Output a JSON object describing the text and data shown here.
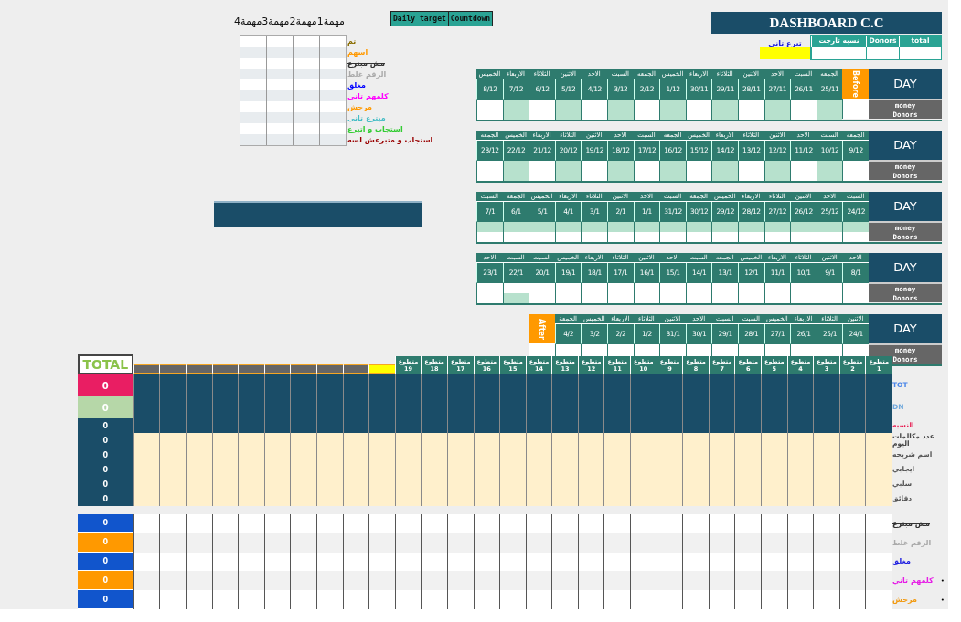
{
  "tasks": {
    "headings": [
      "مهمة1",
      "مهمة2",
      "مهمة3",
      "مهمة4"
    ],
    "statuses": [
      {
        "label": "تم",
        "color": "#8a6d00",
        "struck": false
      },
      {
        "label": "اسهم",
        "color": "#ff9900",
        "struck": false
      },
      {
        "label": "مش مبترع",
        "color": "#333333",
        "struck": true
      },
      {
        "label": "الرقم غلط",
        "color": "#aaaaaa",
        "struck": false
      },
      {
        "label": "مغلق",
        "color": "#0000ff",
        "struck": false
      },
      {
        "label": "كلمهم تاني",
        "color": "#ff00ff",
        "struck": false
      },
      {
        "label": "مرحش",
        "color": "#ff9900",
        "struck": false
      },
      {
        "label": "مبترع تاني",
        "color": "#46bdc6",
        "struck": false
      },
      {
        "label": "استجاب و اتبرع",
        "color": "#33cc33",
        "struck": false
      },
      {
        "label": "استجاب و متبرعش لسه",
        "color": "#990000",
        "struck": false
      }
    ]
  },
  "buttons": [
    {
      "label": "Countdown"
    },
    {
      "label": "Daily target"
    }
  ],
  "dashboard": {
    "title": "DASHBOARD C.C",
    "second_donation": "تبرع تاني",
    "summary_columns": [
      "total",
      "Donors",
      "نسبه تارجت"
    ]
  },
  "weeks": [
    {
      "edge": {
        "kind": "before",
        "label": "Before"
      },
      "day_label": "DAY",
      "money_label": "money",
      "donors_label": "Donors",
      "days": [
        {
          "name": "الجمعه",
          "date": "25/11",
          "money_shaded": true,
          "donors_shaded": true
        },
        {
          "name": "السبت",
          "date": "26/11",
          "money_shaded": false,
          "donors_shaded": false
        },
        {
          "name": "الاحد",
          "date": "27/11",
          "money_shaded": true,
          "donors_shaded": true
        },
        {
          "name": "الاثنين",
          "date": "28/11",
          "money_shaded": false,
          "donors_shaded": false
        },
        {
          "name": "الثلاثاء",
          "date": "29/11",
          "money_shaded": true,
          "donors_shaded": true
        },
        {
          "name": "الاربعاء",
          "date": "30/11",
          "money_shaded": false,
          "donors_shaded": false
        },
        {
          "name": "الخميس",
          "date": "1/12",
          "money_shaded": true,
          "donors_shaded": true
        },
        {
          "name": "الجمعه",
          "date": "2/12",
          "money_shaded": false,
          "donors_shaded": false
        },
        {
          "name": "السبت",
          "date": "3/12",
          "money_shaded": true,
          "donors_shaded": true
        },
        {
          "name": "الاحد",
          "date": "4/12",
          "money_shaded": false,
          "donors_shaded": false
        },
        {
          "name": "الاثنين",
          "date": "5/12",
          "money_shaded": true,
          "donors_shaded": true
        },
        {
          "name": "الثلاثاء",
          "date": "6/12",
          "money_shaded": false,
          "donors_shaded": false
        },
        {
          "name": "الاربعاء",
          "date": "7/12",
          "money_shaded": true,
          "donors_shaded": true
        },
        {
          "name": "الخميس",
          "date": "8/12",
          "money_shaded": false,
          "donors_shaded": false
        }
      ]
    },
    {
      "day_label": "DAY",
      "money_label": "money",
      "donors_label": "Donors",
      "days": [
        {
          "name": "الجمعه",
          "date": "9/12",
          "money_shaded": false,
          "donors_shaded": false
        },
        {
          "name": "السبت",
          "date": "10/12",
          "money_shaded": true,
          "donors_shaded": true
        },
        {
          "name": "الاحد",
          "date": "11/12",
          "money_shaded": false,
          "donors_shaded": false
        },
        {
          "name": "الاثنين",
          "date": "12/12",
          "money_shaded": true,
          "donors_shaded": true
        },
        {
          "name": "الثلاثاء",
          "date": "13/12",
          "money_shaded": false,
          "donors_shaded": false
        },
        {
          "name": "الاربعاء",
          "date": "14/12",
          "money_shaded": true,
          "donors_shaded": true
        },
        {
          "name": "الخميس",
          "date": "15/12",
          "money_shaded": false,
          "donors_shaded": false
        },
        {
          "name": "الجمعه",
          "date": "16/12",
          "money_shaded": true,
          "donors_shaded": true
        },
        {
          "name": "السبت",
          "date": "17/12",
          "money_shaded": false,
          "donors_shaded": false
        },
        {
          "name": "الاحد",
          "date": "18/12",
          "money_shaded": true,
          "donors_shaded": true
        },
        {
          "name": "الاثنين",
          "date": "19/12",
          "money_shaded": false,
          "donors_shaded": false
        },
        {
          "name": "الثلاثاء",
          "date": "20/12",
          "money_shaded": true,
          "donors_shaded": true
        },
        {
          "name": "الاربعاء",
          "date": "21/12",
          "money_shaded": false,
          "donors_shaded": false
        },
        {
          "name": "الخميس",
          "date": "22/12",
          "money_shaded": true,
          "donors_shaded": true
        },
        {
          "name": "الجمعه",
          "date": "23/12",
          "money_shaded": false,
          "donors_shaded": false
        }
      ]
    },
    {
      "day_label": "DAY",
      "money_label": "money",
      "donors_label": "Donors",
      "days": [
        {
          "name": "السبت",
          "date": "24/12",
          "money_shaded": true,
          "donors_shaded": false
        },
        {
          "name": "الاحد",
          "date": "25/12",
          "money_shaded": true,
          "donors_shaded": false
        },
        {
          "name": "الاثنين",
          "date": "26/12",
          "money_shaded": true,
          "donors_shaded": false
        },
        {
          "name": "الثلاثاء",
          "date": "27/12",
          "money_shaded": true,
          "donors_shaded": false
        },
        {
          "name": "الاربعاء",
          "date": "28/12",
          "money_shaded": true,
          "donors_shaded": false
        },
        {
          "name": "الخميس",
          "date": "29/12",
          "money_shaded": true,
          "donors_shaded": false
        },
        {
          "name": "الجمعه",
          "date": "30/12",
          "money_shaded": true,
          "donors_shaded": false
        },
        {
          "name": "السبت",
          "date": "31/12",
          "money_shaded": true,
          "donors_shaded": false
        },
        {
          "name": "الاحد",
          "date": "1/1",
          "money_shaded": true,
          "donors_shaded": false
        },
        {
          "name": "الاثنين",
          "date": "2/1",
          "money_shaded": true,
          "donors_shaded": false
        },
        {
          "name": "الثلاثاء",
          "date": "3/1",
          "money_shaded": true,
          "donors_shaded": false
        },
        {
          "name": "الاربعاء",
          "date": "4/1",
          "money_shaded": true,
          "donors_shaded": false
        },
        {
          "name": "الخميس",
          "date": "5/1",
          "money_shaded": true,
          "donors_shaded": false
        },
        {
          "name": "الجمعه",
          "date": "6/1",
          "money_shaded": true,
          "donors_shaded": false
        },
        {
          "name": "السبت",
          "date": "7/1",
          "money_shaded": true,
          "donors_shaded": false
        }
      ]
    },
    {
      "day_label": "DAY",
      "money_label": "money",
      "donors_label": "Donors",
      "days": [
        {
          "name": "الاحد",
          "date": "8/1",
          "money_shaded": false,
          "donors_shaded": false
        },
        {
          "name": "الاثنين",
          "date": "9/1",
          "money_shaded": false,
          "donors_shaded": false
        },
        {
          "name": "الثلاثاء",
          "date": "10/1",
          "money_shaded": false,
          "donors_shaded": false
        },
        {
          "name": "الاربعاء",
          "date": "11/1",
          "money_shaded": false,
          "donors_shaded": false
        },
        {
          "name": "الخميس",
          "date": "12/1",
          "money_shaded": false,
          "donors_shaded": false
        },
        {
          "name": "الجمعه",
          "date": "13/1",
          "money_shaded": false,
          "donors_shaded": false
        },
        {
          "name": "السبت",
          "date": "14/1",
          "money_shaded": false,
          "donors_shaded": false
        },
        {
          "name": "الاحد",
          "date": "15/1",
          "money_shaded": false,
          "donors_shaded": false
        },
        {
          "name": "الاثنين",
          "date": "16/1",
          "money_shaded": false,
          "donors_shaded": false
        },
        {
          "name": "الثلاثاء",
          "date": "17/1",
          "money_shaded": false,
          "donors_shaded": false
        },
        {
          "name": "الاربعاء",
          "date": "18/1",
          "money_shaded": false,
          "donors_shaded": false
        },
        {
          "name": "الخميس",
          "date": "19/1",
          "money_shaded": false,
          "donors_shaded": false
        },
        {
          "name": "السبت",
          "date": "20/1",
          "money_shaded": false,
          "donors_shaded": false
        },
        {
          "name": "السبت",
          "date": "22/1",
          "money_shaded": false,
          "donors_shaded": true
        },
        {
          "name": "الاحد",
          "date": "23/1",
          "money_shaded": false,
          "donors_shaded": false
        }
      ]
    },
    {
      "edge": {
        "kind": "after",
        "label": "After"
      },
      "day_label": "DAY",
      "money_label": "money",
      "donors_label": "Donors",
      "days": [
        {
          "name": "الاثنين",
          "date": "24/1",
          "money_shaded": false,
          "donors_shaded": false
        },
        {
          "name": "الثلاثاء",
          "date": "25/1",
          "money_shaded": false,
          "donors_shaded": false
        },
        {
          "name": "الاربعاء",
          "date": "26/1",
          "money_shaded": false,
          "donors_shaded": false
        },
        {
          "name": "الخميس",
          "date": "27/1",
          "money_shaded": false,
          "donors_shaded": false
        },
        {
          "name": "السبت",
          "date": "28/1",
          "money_shaded": false,
          "donors_shaded": false
        },
        {
          "name": "السبت",
          "date": "29/1",
          "money_shaded": false,
          "donors_shaded": false
        },
        {
          "name": "الاحد",
          "date": "30/1",
          "money_shaded": false,
          "donors_shaded": false
        },
        {
          "name": "الاثنين",
          "date": "31/1",
          "money_shaded": false,
          "donors_shaded": false
        },
        {
          "name": "الثلاثاء",
          "date": "1/2",
          "money_shaded": false,
          "donors_shaded": false
        },
        {
          "name": "الاربعاء",
          "date": "2/2",
          "money_shaded": false,
          "donors_shaded": false
        },
        {
          "name": "الخميس",
          "date": "3/2",
          "money_shaded": false,
          "donors_shaded": false
        },
        {
          "name": "الجمعة",
          "date": "4/2",
          "money_shaded": false,
          "donors_shaded": false
        }
      ]
    }
  ],
  "volunteer_table": {
    "total_label": "TOTAL",
    "columns": [
      {
        "kind": "volunteer",
        "label": "متطوع 1"
      },
      {
        "kind": "volunteer",
        "label": "متطوع 2"
      },
      {
        "kind": "volunteer",
        "label": "متطوع 3"
      },
      {
        "kind": "volunteer",
        "label": "متطوع 4"
      },
      {
        "kind": "volunteer",
        "label": "متطوع 5"
      },
      {
        "kind": "volunteer",
        "label": "متطوع 6"
      },
      {
        "kind": "volunteer",
        "label": "متطوع 7"
      },
      {
        "kind": "volunteer",
        "label": "متطوع 8"
      },
      {
        "kind": "volunteer",
        "label": "متطوع 9"
      },
      {
        "kind": "volunteer",
        "label": "متطوع 10"
      },
      {
        "kind": "volunteer",
        "label": "متطوع 11"
      },
      {
        "kind": "volunteer",
        "label": "متطوع 12"
      },
      {
        "kind": "volunteer",
        "label": "متطوع 13"
      },
      {
        "kind": "volunteer",
        "label": "متطوع 14"
      },
      {
        "kind": "volunteer",
        "label": "متطوع 15"
      },
      {
        "kind": "volunteer",
        "label": "متطوع 16"
      },
      {
        "kind": "volunteer",
        "label": "متطوع 17"
      },
      {
        "kind": "volunteer",
        "label": "متطوع 18"
      },
      {
        "kind": "volunteer",
        "label": "متطوع 19"
      },
      {
        "kind": "highlight"
      },
      {
        "kind": "blank"
      },
      {
        "kind": "blank"
      },
      {
        "kind": "blank"
      },
      {
        "kind": "blank"
      },
      {
        "kind": "blank"
      },
      {
        "kind": "blank"
      },
      {
        "kind": "blank"
      },
      {
        "kind": "blank"
      },
      {
        "kind": "blank"
      }
    ],
    "rows": [
      {
        "kind": "total",
        "label": "TOT",
        "color": "#4a86e8",
        "total": {
          "value": "0",
          "color": "#e91e63"
        }
      },
      {
        "kind": "total",
        "label": "DN",
        "color": "#6fa8dc",
        "total": {
          "value": "0",
          "color": "#b6d7a8"
        }
      },
      {
        "kind": "ratio",
        "label": "النسبه",
        "color": "#e8174e",
        "total": {
          "value": "0",
          "color": "#1a4d68"
        }
      },
      {
        "kind": "count",
        "label": "عدد مكالمات اليوم",
        "color": "#444444",
        "total": {
          "value": "0",
          "color": "#1a4d68"
        }
      },
      {
        "kind": "count",
        "label": "اسم شريحه",
        "color": "#555555",
        "total": {
          "value": "0",
          "color": "#1a4d68"
        }
      },
      {
        "kind": "count",
        "label": "ايجابي",
        "color": "#555555",
        "total": {
          "value": "0",
          "color": "#1a4d68"
        }
      },
      {
        "kind": "count",
        "label": "سلبي",
        "color": "#555555",
        "total": {
          "value": "0",
          "color": "#1a4d68"
        }
      },
      {
        "kind": "count",
        "label": "دقائق",
        "color": "#555555",
        "total": {
          "value": "0",
          "color": "#1a4d68"
        }
      }
    ]
  },
  "status_table": {
    "rows": [
      {
        "label": "مش مبترع",
        "color": "#333333",
        "struck": true,
        "total": {
          "value": "0",
          "color": "#1155cc"
        }
      },
      {
        "label": "الرقم غلط",
        "color": "#aaaaaa",
        "struck": false,
        "total": {
          "value": "0",
          "color": "#ff9900"
        }
      },
      {
        "label": "مغلق",
        "color": "#1c1ce0",
        "struck": false,
        "total": {
          "value": "0",
          "color": "#1155cc"
        }
      },
      {
        "label": "كلمهم تاني",
        "color": "#e61ee6",
        "struck": false,
        "total": {
          "value": "0",
          "color": "#ff9900"
        },
        "marker": "•"
      },
      {
        "label": "مرحش",
        "color": "#f29a10",
        "struck": false,
        "total": {
          "value": "0",
          "color": "#1155cc"
        },
        "marker": "•"
      }
    ]
  }
}
